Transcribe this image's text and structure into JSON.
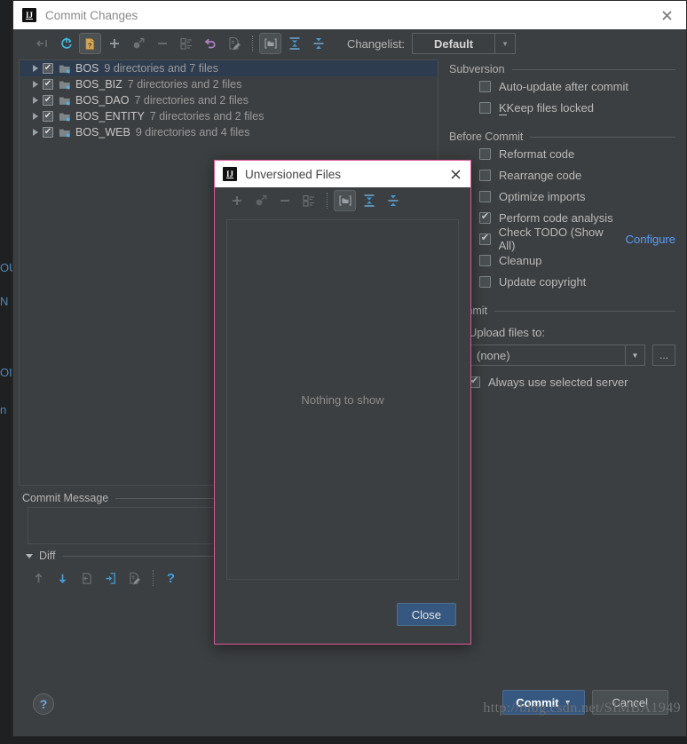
{
  "window": {
    "title": "Commit Changes",
    "logo": "intellij-idea-logo",
    "close_icon": "close-icon"
  },
  "toolbar": {
    "items": [
      {
        "name": "show-diff-icon",
        "enabled": false
      },
      {
        "name": "refresh-icon",
        "enabled": true
      },
      {
        "name": "unversioned-files-icon",
        "enabled": true,
        "selected": true
      },
      {
        "name": "add-icon",
        "enabled": true
      },
      {
        "name": "move-to-changelist-icon",
        "enabled": false
      },
      {
        "name": "remove-icon",
        "enabled": false
      },
      {
        "name": "checkbox-list-icon",
        "enabled": false
      },
      {
        "name": "revert-icon",
        "enabled": true
      },
      {
        "name": "edit-source-icon",
        "enabled": false
      },
      {
        "name": "group-by-directory-icon",
        "enabled": true,
        "selected": true
      },
      {
        "name": "expand-all-icon",
        "enabled": true
      },
      {
        "name": "collapse-all-icon",
        "enabled": true
      }
    ],
    "changelist_label": "Changelist:",
    "changelist_value": "Default"
  },
  "tree": {
    "rows": [
      {
        "name": "BOS",
        "description": "9 directories and 7 files",
        "checked": true,
        "selected": true
      },
      {
        "name": "BOS_BIZ",
        "description": "7 directories and 2 files",
        "checked": true,
        "selected": false
      },
      {
        "name": "BOS_DAO",
        "description": "7 directories and 2 files",
        "checked": true,
        "selected": false
      },
      {
        "name": "BOS_ENTITY",
        "description": "7 directories and 2 files",
        "checked": true,
        "selected": false
      },
      {
        "name": "BOS_WEB",
        "description": "9 directories and 4 files",
        "checked": true,
        "selected": false
      }
    ]
  },
  "commit_message": {
    "section_label": "Commit Message",
    "value": "",
    "placeholder": ""
  },
  "diff": {
    "section_label": "Diff",
    "icons": [
      {
        "name": "previous-difference-icon",
        "enabled": false
      },
      {
        "name": "next-difference-icon",
        "enabled": true
      },
      {
        "name": "revert-chunk-icon",
        "enabled": false
      },
      {
        "name": "apply-chunk-icon",
        "enabled": true
      },
      {
        "name": "edit-source-icon",
        "enabled": false
      },
      {
        "name": "help-icon",
        "enabled": true
      }
    ]
  },
  "options": {
    "subversion": {
      "title": "Subversion",
      "items": [
        {
          "label": "Auto-update after commit",
          "checked": false,
          "mnemonic": ""
        },
        {
          "label": "Keep files locked",
          "checked": false,
          "mnemonic": "K"
        }
      ]
    },
    "before_commit": {
      "title": "Before Commit",
      "items": [
        {
          "label": "Reformat code",
          "checked": false,
          "mnemonic": "R"
        },
        {
          "label": "Rearrange code",
          "checked": false,
          "mnemonic": "n"
        },
        {
          "label": "Optimize imports",
          "checked": false,
          "mnemonic": "O"
        },
        {
          "label": "Perform code analysis",
          "checked": true,
          "mnemonic": "s"
        },
        {
          "label": "Check TODO (Show All)",
          "checked": true,
          "mnemonic": "",
          "link": "Configure"
        },
        {
          "label": "Cleanup",
          "checked": false,
          "mnemonic": "l"
        },
        {
          "label": "Update copyright",
          "checked": false,
          "mnemonic": ""
        }
      ]
    },
    "commit": {
      "title": "Commit",
      "upload_label": "Upload files to:",
      "upload_value": "(none)",
      "browse_label": "...",
      "always_use_label": "Always use selected server",
      "always_use_checked": true
    }
  },
  "dialog": {
    "title": "Unversioned Files",
    "logo": "intellij-idea-logo",
    "close_icon": "close-icon",
    "toolbar": [
      {
        "name": "add-icon",
        "enabled": false
      },
      {
        "name": "move-to-changelist-icon",
        "enabled": false
      },
      {
        "name": "remove-icon",
        "enabled": false
      },
      {
        "name": "checkbox-list-icon",
        "enabled": false
      },
      {
        "name": "group-by-directory-icon",
        "enabled": true,
        "selected": true
      },
      {
        "name": "expand-all-icon",
        "enabled": true
      },
      {
        "name": "collapse-all-icon",
        "enabled": true
      }
    ],
    "empty_text": "Nothing to show",
    "close_button": "Close"
  },
  "footer": {
    "help_icon": "help-icon",
    "commit_button": "Commit",
    "cancel_button": "Cancel"
  },
  "watermark": "http://blog.csdn.net/SIMBA1949",
  "background_bleed": [
    "OU",
    "N",
    "OI",
    "n"
  ],
  "colors": {
    "background": "#3c3f41",
    "selection": "#2e3c4f",
    "accent_blue": "#589df6",
    "default_button": "#365880",
    "dialog_border": "#e0569a",
    "titlebar": "#ffffff"
  }
}
